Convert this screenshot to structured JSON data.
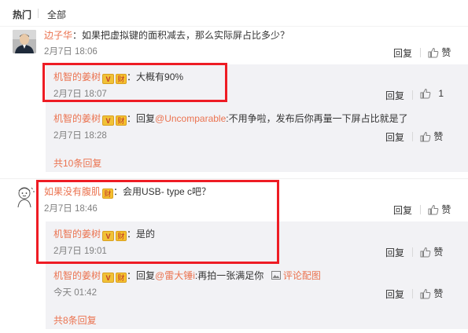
{
  "tabs": {
    "hot": "热门",
    "all": "全部"
  },
  "common": {
    "reply": "回复",
    "like": "赞"
  },
  "thread1": {
    "comment": {
      "user": "边子华",
      "text": "：如果把虚拟键的面积减去，那么实际屏占比多少？",
      "time": "2月7日 18:06"
    },
    "replies": [
      {
        "user": "机智的姜树",
        "badge_v": "V",
        "badge_cai": "财",
        "text": "：大概有90%",
        "time": "2月7日 18:07",
        "like_count": "1"
      },
      {
        "user": "机智的姜树",
        "badge_v": "V",
        "badge_cai": "财",
        "text_prefix": "：回复",
        "mention": "@Uncomparable",
        "text": ":不用争啦，发布后你再量一下屏占比就是了",
        "time": "2月7日 18:28"
      }
    ],
    "more": "共10条回复"
  },
  "thread2": {
    "comment": {
      "user": "如果没有腹肌",
      "badge_cai": "财",
      "text": "：会用USB- type c吧？",
      "time": "2月7日 18:46"
    },
    "replies": [
      {
        "user": "机智的姜树",
        "badge_v": "V",
        "badge_cai": "财",
        "text": "：是的",
        "time": "2月7日 19:01"
      },
      {
        "user": "机智的姜树",
        "badge_v": "V",
        "badge_cai": "财",
        "text_prefix": "：回复",
        "mention": "@雷大锤i",
        "text": ":再拍一张满足你",
        "image_link": "评论配图",
        "time": "今天 01:42"
      }
    ],
    "more": "共8条回复"
  },
  "colors": {
    "username": "#eb7350",
    "highlight_box": "#ee1c24",
    "sub_bg": "#f2f2f5"
  }
}
